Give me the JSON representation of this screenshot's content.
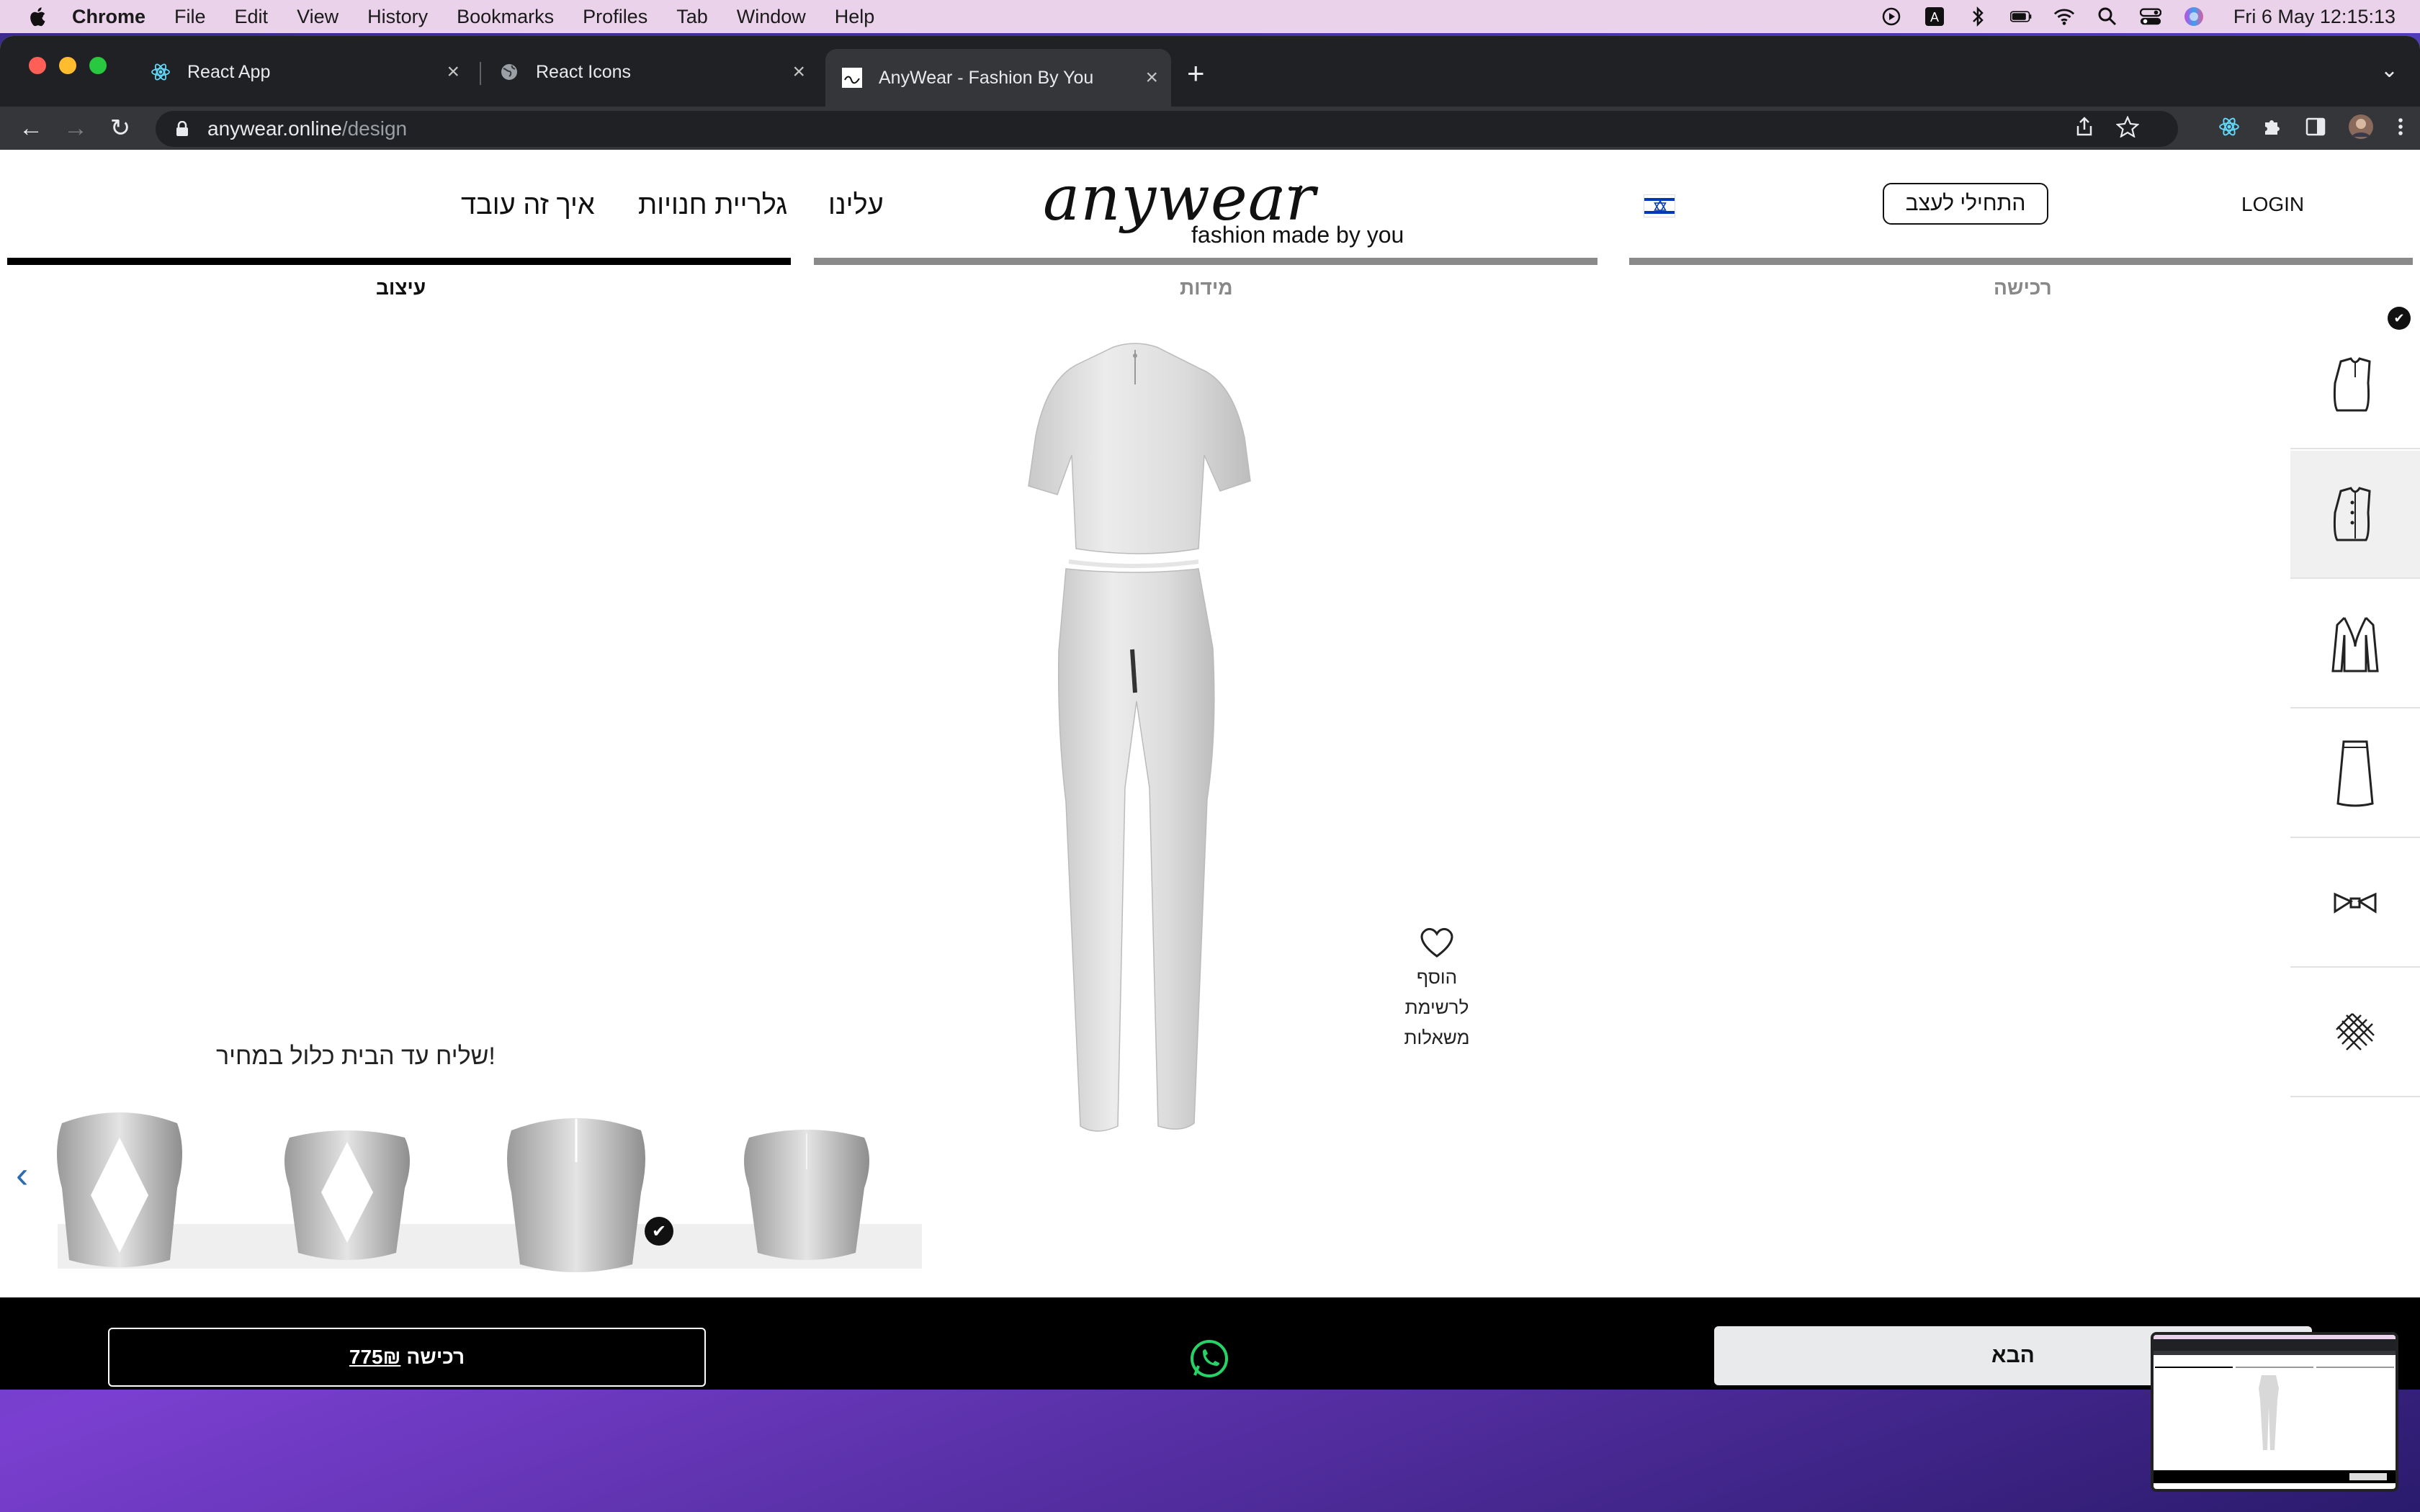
{
  "menubar": {
    "app": "Chrome",
    "items": [
      "File",
      "Edit",
      "View",
      "History",
      "Bookmarks",
      "Profiles",
      "Tab",
      "Window",
      "Help"
    ],
    "clock": "Fri 6 May  12:15:13",
    "tray_icons": [
      "play-icon",
      "keyboard-a-icon",
      "bluetooth-icon",
      "battery-icon",
      "wifi-icon",
      "search-icon",
      "control-center-icon",
      "siri-icon"
    ]
  },
  "browser": {
    "tabs": [
      {
        "title": "React App",
        "icon": "react-icon"
      },
      {
        "title": "React Icons",
        "icon": "globe-icon"
      },
      {
        "title": "AnyWear - Fashion By You",
        "icon": "anywear-favicon"
      }
    ],
    "url_host": "anywear.online",
    "url_path": "/design"
  },
  "site": {
    "nav": {
      "how_it_works": "איך זה עובד",
      "store_gallery": "גלריית חנויות",
      "about": "עלינו"
    },
    "logo": {
      "script": "anywear",
      "tagline": "fashion made by you"
    },
    "start_button": "התחילי לעצב",
    "login": "LOGIN",
    "steps": [
      {
        "label": "עיצוב",
        "active": true
      },
      {
        "label": "מידות",
        "active": false
      },
      {
        "label": "רכישה",
        "active": false
      }
    ],
    "wishlist": {
      "line1": "הוסף",
      "line2": "לרשימת",
      "line3": "משאלות"
    },
    "shipping_note": "שליח עד הבית כלול במחיר!",
    "carousel": {
      "arrow": "‹",
      "options": [
        {
          "name": "diamond-cutout-back-large",
          "selected": false
        },
        {
          "name": "diamond-cutout-back-small",
          "selected": false
        },
        {
          "name": "closed-back-seam",
          "selected": true
        },
        {
          "name": "closed-back-plain",
          "selected": false
        }
      ]
    },
    "sidebar": [
      {
        "icon": "top-garment-icon",
        "selected": false,
        "checked": true
      },
      {
        "icon": "buttoned-top-icon",
        "selected": true,
        "checked": false
      },
      {
        "icon": "jacket-icon",
        "selected": false,
        "checked": false
      },
      {
        "icon": "skirt-icon",
        "selected": false,
        "checked": false
      },
      {
        "icon": "bow-icon",
        "selected": false,
        "checked": false
      },
      {
        "icon": "fabric-pattern-icon",
        "selected": false,
        "checked": false
      }
    ],
    "bottom": {
      "purchase_label": "רכישה",
      "price": "775₪",
      "next_label": "הבא",
      "whatsapp_icon": "whatsapp-icon"
    }
  },
  "colors": {
    "brand": "#000000",
    "accent_blue": "#0038b8",
    "whatsapp": "#25D366"
  }
}
